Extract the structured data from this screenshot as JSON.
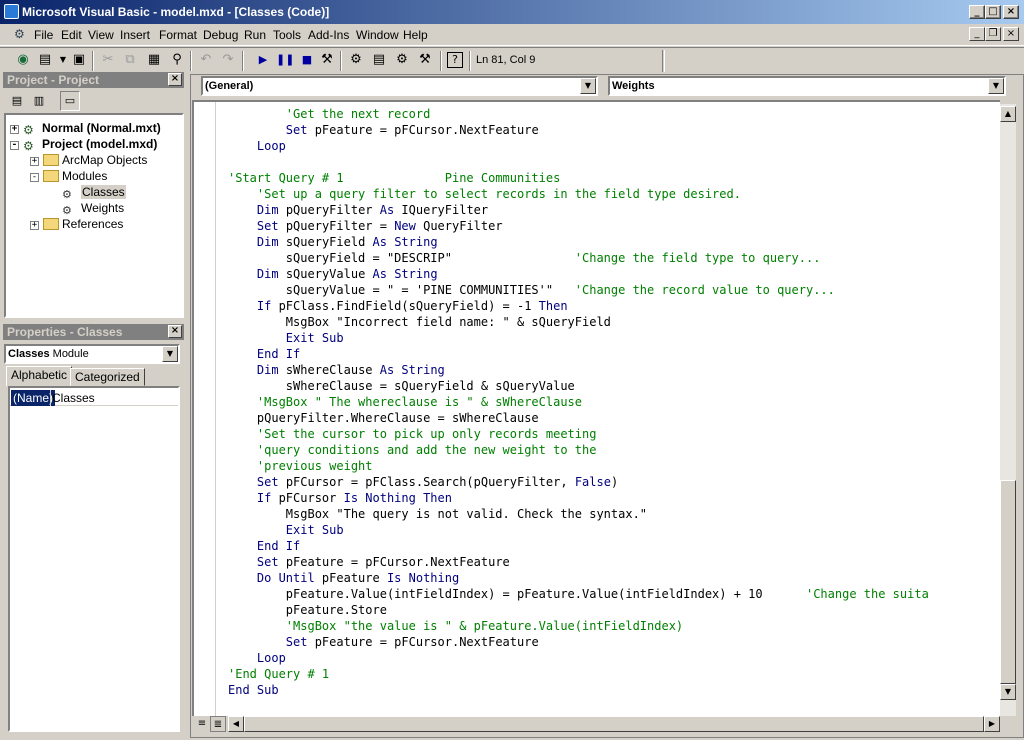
{
  "window": {
    "title": "Microsoft Visual Basic - model.mxd - [Classes (Code)]"
  },
  "menu": [
    "File",
    "Edit",
    "View",
    "Insert",
    "Format",
    "Debug",
    "Run",
    "Tools",
    "Add-Ins",
    "Window",
    "Help"
  ],
  "toolbar": {
    "cursor_position": "Ln 81, Col 9"
  },
  "project_panel": {
    "title": "Project - Project",
    "tree": [
      {
        "label": "Normal (Normal.mxt)",
        "bold": true
      },
      {
        "label": "Project (model.mxd)",
        "bold": true
      },
      {
        "label": "ArcMap Objects"
      },
      {
        "label": "Modules"
      },
      {
        "label": "Classes",
        "selected": true
      },
      {
        "label": "Weights"
      },
      {
        "label": "References"
      }
    ]
  },
  "properties_panel": {
    "title": "Properties - Classes",
    "object_name": "Classes",
    "object_type": "Module",
    "tabs": [
      "Alphabetic",
      "Categorized"
    ],
    "property_name": "(Name)",
    "property_value": "Classes"
  },
  "code_window": {
    "object_combo": "(General)",
    "procedure_combo": "Weights",
    "lines": [
      [
        [
          "cm",
          "        'Get the next record"
        ]
      ],
      [
        [
          "tx",
          "        "
        ],
        [
          "kw",
          "Set"
        ],
        [
          "tx",
          " pFeature = pFCursor.NextFeature"
        ]
      ],
      [
        [
          "tx",
          "    "
        ],
        [
          "kw",
          "Loop"
        ]
      ],
      [
        [
          "tx",
          ""
        ]
      ],
      [
        [
          "cm",
          "'Start Query # 1              Pine Communities"
        ]
      ],
      [
        [
          "cm",
          "    'Set up a query filter to select records in the field type desired."
        ]
      ],
      [
        [
          "tx",
          "    "
        ],
        [
          "kw",
          "Dim"
        ],
        [
          "tx",
          " pQueryFilter "
        ],
        [
          "kw",
          "As"
        ],
        [
          "tx",
          " IQueryFilter"
        ]
      ],
      [
        [
          "tx",
          "    "
        ],
        [
          "kw",
          "Set"
        ],
        [
          "tx",
          " pQueryFilter = "
        ],
        [
          "kw",
          "New"
        ],
        [
          "tx",
          " QueryFilter"
        ]
      ],
      [
        [
          "tx",
          "    "
        ],
        [
          "kw",
          "Dim"
        ],
        [
          "tx",
          " sQueryField "
        ],
        [
          "kw",
          "As String"
        ]
      ],
      [
        [
          "tx",
          "        sQueryField = \"DESCRIP\"                 "
        ],
        [
          "cm",
          "'Change the field type to query..."
        ]
      ],
      [
        [
          "tx",
          "    "
        ],
        [
          "kw",
          "Dim"
        ],
        [
          "tx",
          " sQueryValue "
        ],
        [
          "kw",
          "As String"
        ]
      ],
      [
        [
          "tx",
          "        sQueryValue = \" = 'PINE COMMUNITIES'\"   "
        ],
        [
          "cm",
          "'Change the record value to query..."
        ]
      ],
      [
        [
          "tx",
          "    "
        ],
        [
          "kw",
          "If"
        ],
        [
          "tx",
          " pFClass.FindField(sQueryField) = -1 "
        ],
        [
          "kw",
          "Then"
        ]
      ],
      [
        [
          "tx",
          "        MsgBox \"Incorrect field name: \" & sQueryField"
        ]
      ],
      [
        [
          "tx",
          "        "
        ],
        [
          "kw",
          "Exit Sub"
        ]
      ],
      [
        [
          "tx",
          "    "
        ],
        [
          "kw",
          "End If"
        ]
      ],
      [
        [
          "tx",
          "    "
        ],
        [
          "kw",
          "Dim"
        ],
        [
          "tx",
          " sWhereClause "
        ],
        [
          "kw",
          "As String"
        ]
      ],
      [
        [
          "tx",
          "        sWhereClause = sQueryField & sQueryValue"
        ]
      ],
      [
        [
          "cm",
          "    'MsgBox \" The whereclause is \" & sWhereClause"
        ]
      ],
      [
        [
          "tx",
          "    pQueryFilter.WhereClause = sWhereClause"
        ]
      ],
      [
        [
          "cm",
          "    'Set the cursor to pick up only records meeting"
        ]
      ],
      [
        [
          "cm",
          "    'query conditions and add the new weight to the"
        ]
      ],
      [
        [
          "cm",
          "    'previous weight"
        ]
      ],
      [
        [
          "tx",
          "    "
        ],
        [
          "kw",
          "Set"
        ],
        [
          "tx",
          " pFCursor = pFClass.Search(pQueryFilter, "
        ],
        [
          "kw",
          "False"
        ],
        [
          "tx",
          ")"
        ]
      ],
      [
        [
          "tx",
          "    "
        ],
        [
          "kw",
          "If"
        ],
        [
          "tx",
          " pFCursor "
        ],
        [
          "kw",
          "Is Nothing Then"
        ]
      ],
      [
        [
          "tx",
          "        MsgBox \"The query is not valid. Check the syntax.\""
        ]
      ],
      [
        [
          "tx",
          "        "
        ],
        [
          "kw",
          "Exit Sub"
        ]
      ],
      [
        [
          "tx",
          "    "
        ],
        [
          "kw",
          "End If"
        ]
      ],
      [
        [
          "tx",
          "    "
        ],
        [
          "kw",
          "Set"
        ],
        [
          "tx",
          " pFeature = pFCursor.NextFeature"
        ]
      ],
      [
        [
          "tx",
          "    "
        ],
        [
          "kw",
          "Do Until"
        ],
        [
          "tx",
          " pFeature "
        ],
        [
          "kw",
          "Is Nothing"
        ]
      ],
      [
        [
          "tx",
          "        pFeature.Value(intFieldIndex) = pFeature.Value(intFieldIndex) + 10      "
        ],
        [
          "cm",
          "'Change the suita"
        ]
      ],
      [
        [
          "tx",
          "        pFeature.Store"
        ]
      ],
      [
        [
          "cm",
          "        'MsgBox \"the value is \" & pFeature.Value(intFieldIndex)"
        ]
      ],
      [
        [
          "tx",
          "        "
        ],
        [
          "kw",
          "Set"
        ],
        [
          "tx",
          " pFeature = pFCursor.NextFeature"
        ]
      ],
      [
        [
          "tx",
          "    "
        ],
        [
          "kw",
          "Loop"
        ]
      ],
      [
        [
          "cm",
          "'End Query # 1"
        ]
      ],
      [
        [
          "kw",
          "End Sub"
        ]
      ]
    ]
  },
  "colors": {
    "keyword": "#00007f",
    "comment": "#007f00",
    "title_bar": "#0a246a"
  }
}
